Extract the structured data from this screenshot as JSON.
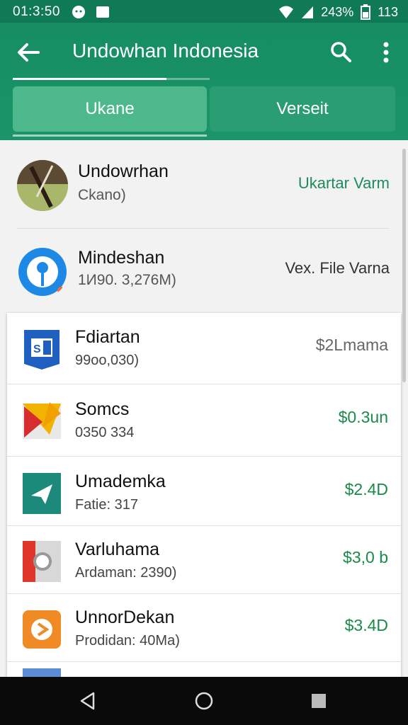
{
  "status_bar": {
    "time": "01:3:50",
    "battery_percent": "243%",
    "extra": "113",
    "icons": [
      "notification-icon",
      "screenshot-icon",
      "wifi-icon",
      "signal-icon",
      "battery-icon"
    ]
  },
  "app_bar": {
    "title": "Undowhan Indonesia",
    "progress": 0.78,
    "icons": [
      "back-arrow-icon",
      "search-icon",
      "more-vert-icon"
    ]
  },
  "tabs": [
    {
      "label": "Ukane",
      "active": true
    },
    {
      "label": "Versеit",
      "active": false
    }
  ],
  "top_items": [
    {
      "name": "Undowrhan",
      "sub": "Ckanо)",
      "right": "Ukartar Varm",
      "right_color": "#1f8a5c",
      "icon": "photo-avatar-icon"
    },
    {
      "name": "Mindeshan",
      "sub": "1И90. 3,276M)",
      "right": "Vex. File Varna",
      "right_color": "#333333",
      "icon": "location-pin-icon"
    }
  ],
  "list": [
    {
      "name": "Fdiartan",
      "sub": "99оо,030)",
      "price": "$2Lmama",
      "price_color": "#666666",
      "icon": "sharepoint-icon"
    },
    {
      "name": "Somcs",
      "sub": "0350 334",
      "price": "$0.3un",
      "price_color": "#1a8a4a",
      "icon": "play-folder-icon"
    },
    {
      "name": "Umademka",
      "sub": "Fatie: 317",
      "price": "$2.4D",
      "price_color": "#1a8a4a",
      "icon": "send-icon"
    },
    {
      "name": "Varluhama",
      "sub": "Ardaman: 2390)",
      "price": "$3,0 b",
      "price_color": "#1a8a4a",
      "icon": "record-icon"
    },
    {
      "name": "UnnorDekan",
      "sub": "Prodidan: 40Ma)",
      "price": "$3.4D",
      "price_color": "#1a8a4a",
      "icon": "video-icon"
    }
  ],
  "colors": {
    "brand_green": "#168d62",
    "tab_active": "#4cb88c",
    "price_green": "#1a8a4a"
  },
  "nav_bar": {
    "icons": [
      "back-triangle-icon",
      "home-circle-icon",
      "recents-square-icon"
    ]
  }
}
